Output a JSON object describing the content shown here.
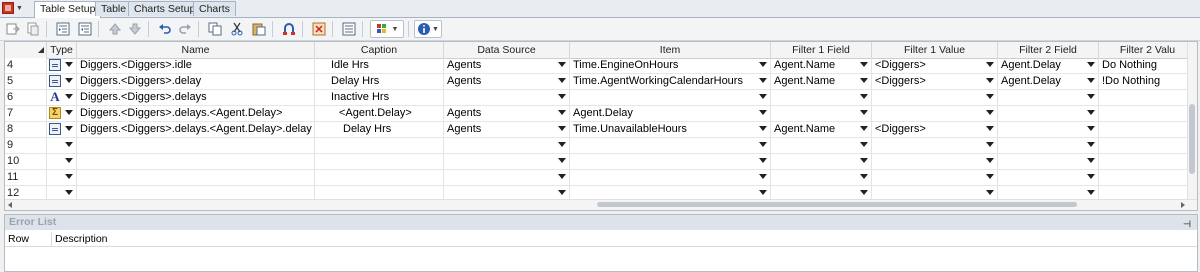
{
  "tabs": [
    "Table Setup",
    "Table",
    "Charts Setup",
    "Charts"
  ],
  "toolbar": {
    "buttons": [
      "export-icon",
      "copy-doc-icon",
      "indent-icon",
      "outdent-icon",
      "move-up-icon",
      "move-down-icon",
      "undo-icon",
      "redo-icon",
      "copy-icon",
      "cut-icon",
      "paste-icon",
      "find-icon",
      "delete-row-icon",
      "properties-icon",
      "color-grid-icon",
      "info-icon"
    ]
  },
  "grid": {
    "columns": [
      "Type",
      "Name",
      "Caption",
      "Data Source",
      "Item",
      "Filter 1 Field",
      "Filter 1 Value",
      "Filter 2 Field",
      "Filter 2 Valu"
    ],
    "rows": [
      {
        "num": "4",
        "type": "list",
        "name": "Diggers.<Diggers>.idle",
        "caption": "Idle Hrs",
        "datasource": "Agents",
        "item": "Time.EngineOnHours",
        "f1field": "Agent.Name",
        "f1value": "<Diggers>",
        "f2field": "Agent.Delay",
        "f2value": "Do Nothing"
      },
      {
        "num": "5",
        "type": "list",
        "name": "Diggers.<Diggers>.delay",
        "caption": "Delay Hrs",
        "datasource": "Agents",
        "item": "Time.AgentWorkingCalendarHours",
        "f1field": "Agent.Name",
        "f1value": "<Diggers>",
        "f2field": "Agent.Delay",
        "f2value": "!Do Nothing"
      },
      {
        "num": "6",
        "type": "text",
        "name": "Diggers.<Diggers>.delays",
        "caption": "Inactive Hrs",
        "datasource": "",
        "item": "",
        "f1field": "",
        "f1value": "",
        "f2field": "",
        "f2value": ""
      },
      {
        "num": "7",
        "type": "sum",
        "name": "Diggers.<Diggers>.delays.<Agent.Delay>",
        "caption": "<Agent.Delay>",
        "datasource": "Agents",
        "item": "Agent.Delay",
        "f1field": "",
        "f1value": "",
        "f2field": "",
        "f2value": ""
      },
      {
        "num": "8",
        "type": "list",
        "name": "Diggers.<Diggers>.delays.<Agent.Delay>.delay",
        "caption": "Delay Hrs",
        "datasource": "Agents",
        "item": "Time.UnavailableHours",
        "f1field": "Agent.Name",
        "f1value": "<Diggers>",
        "f2field": "",
        "f2value": ""
      },
      {
        "num": "9",
        "type": "",
        "name": "",
        "caption": "",
        "datasource": "",
        "item": "",
        "f1field": "",
        "f1value": "",
        "f2field": "",
        "f2value": ""
      },
      {
        "num": "10",
        "type": "",
        "name": "",
        "caption": "",
        "datasource": "",
        "item": "",
        "f1field": "",
        "f1value": "",
        "f2field": "",
        "f2value": ""
      },
      {
        "num": "11",
        "type": "",
        "name": "",
        "caption": "",
        "datasource": "",
        "item": "",
        "f1field": "",
        "f1value": "",
        "f2field": "",
        "f2value": ""
      },
      {
        "num": "12",
        "type": "",
        "name": "",
        "caption": "",
        "datasource": "",
        "item": "",
        "f1field": "",
        "f1value": "",
        "f2field": "",
        "f2value": ""
      }
    ]
  },
  "errors": {
    "title": "Error List",
    "columns": [
      "Row",
      "Description"
    ]
  },
  "colors": {
    "accent": "#3a5a8c",
    "panel_header": "#dde3ea"
  }
}
